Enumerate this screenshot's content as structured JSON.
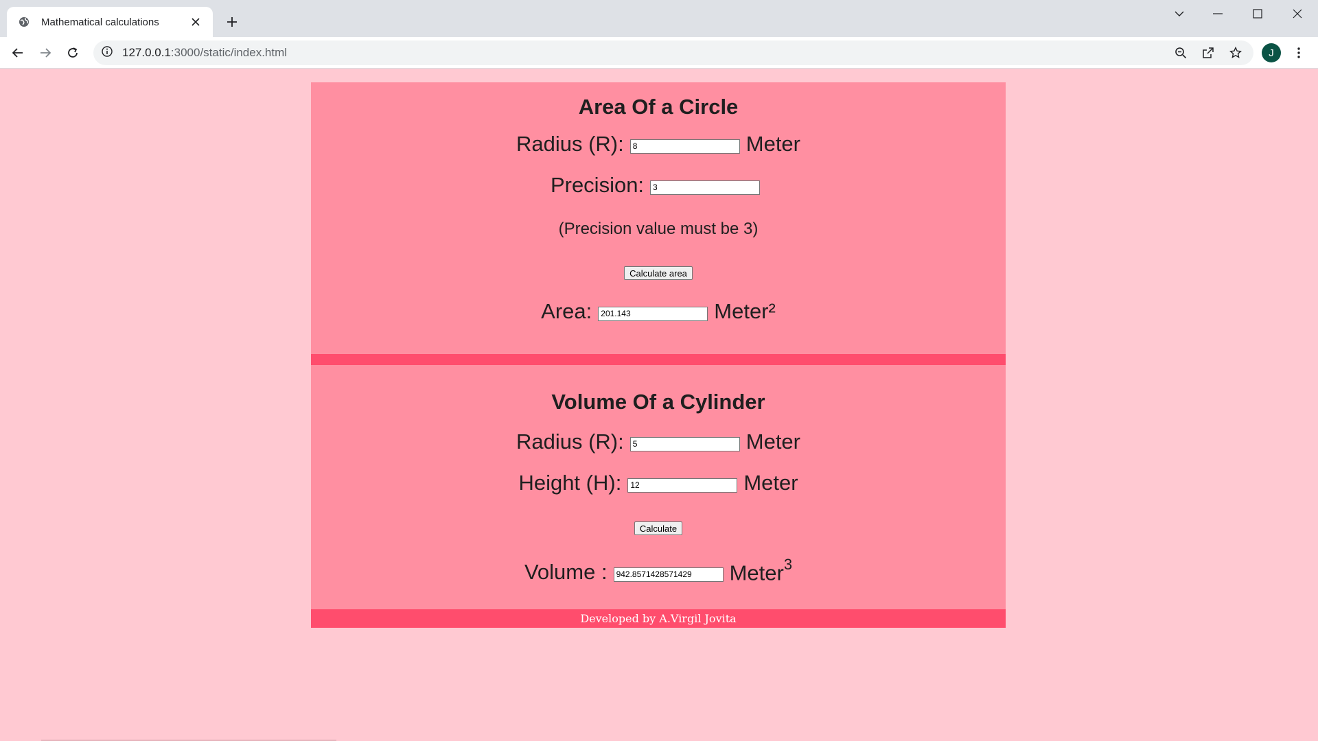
{
  "browser": {
    "tab_title": "Mathematical calculations",
    "new_tab_label": "+",
    "url_host": "127.0.0.1",
    "url_path": ":3000/static/index.html",
    "profile_initial": "J"
  },
  "circle": {
    "title": "Area Of a Circle",
    "radius_label": "Radius (R):",
    "radius_value": "8",
    "radius_unit": "Meter",
    "precision_label": "Precision:",
    "precision_value": "3",
    "precision_note": "(Precision value must be 3)",
    "button_label": "Calculate area",
    "area_label": "Area:",
    "area_value": "201.143",
    "area_unit": "Meter²"
  },
  "cylinder": {
    "title": "Volume Of a Cylinder",
    "radius_label": "Radius (R):",
    "radius_value": "5",
    "radius_unit": "Meter",
    "height_label": "Height (H):",
    "height_value": "12",
    "height_unit": "Meter",
    "button_label": "Calculate",
    "volume_label": "Volume :",
    "volume_value": "942.8571428571429",
    "volume_unit": "Meter",
    "volume_unit_exponent": "3"
  },
  "footer": {
    "text": "Developed by A.Virgil Jovita"
  },
  "colors": {
    "page_bg": "#ffc9d2",
    "card_bg": "#ff8fa1",
    "accent": "#ff4d6d"
  }
}
